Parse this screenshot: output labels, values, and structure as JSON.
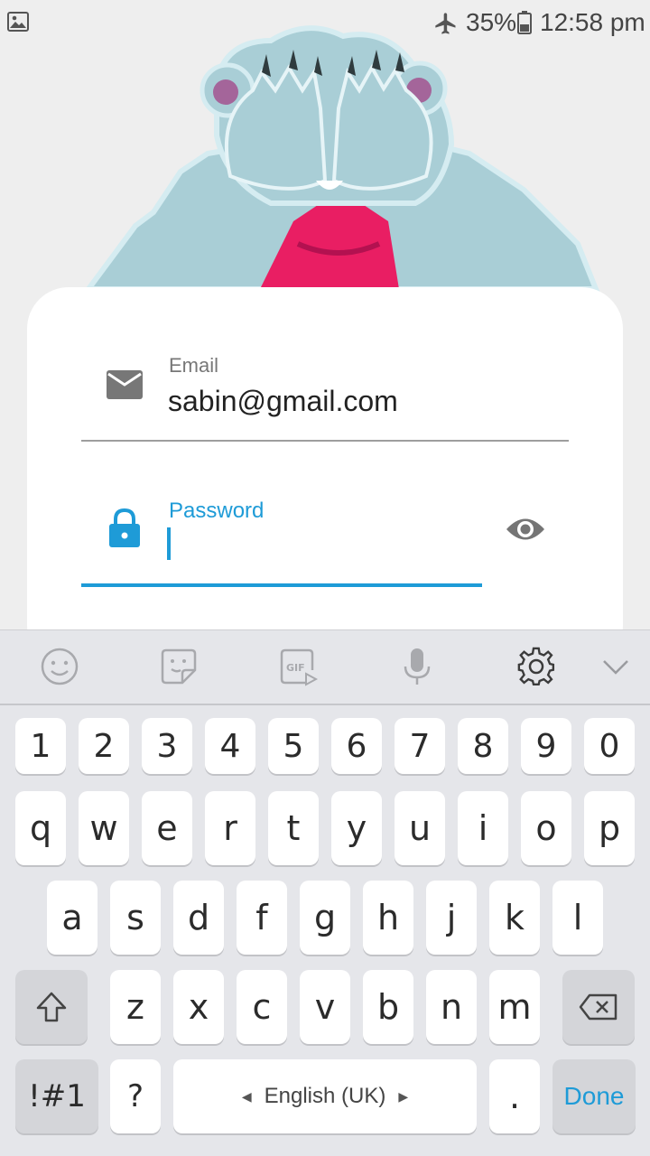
{
  "status_bar": {
    "battery_percent": "35%",
    "time": "12:58 pm"
  },
  "form": {
    "email_label": "Email",
    "email_value": "sabin@gmail.com",
    "password_label": "Password",
    "password_value": ""
  },
  "keyboard": {
    "toolbar_icons": [
      "emoji-icon",
      "sticker-icon",
      "gif-icon",
      "microphone-icon",
      "settings-icon",
      "collapse-icon"
    ],
    "gif_label": "GIF",
    "number_row": [
      "1",
      "2",
      "3",
      "4",
      "5",
      "6",
      "7",
      "8",
      "9",
      "0"
    ],
    "row1": [
      "q",
      "w",
      "e",
      "r",
      "t",
      "y",
      "u",
      "i",
      "o",
      "p"
    ],
    "row2": [
      "a",
      "s",
      "d",
      "f",
      "g",
      "h",
      "j",
      "k",
      "l"
    ],
    "row3": [
      "z",
      "x",
      "c",
      "v",
      "b",
      "n",
      "m"
    ],
    "symbols_label": "!#1",
    "question_label": "?",
    "space_label": "English (UK)",
    "period_label": ".",
    "done_label": "Done"
  },
  "colors": {
    "accent": "#1e9bd7",
    "mascot_fur": "#a9ced6",
    "mascot_shirt": "#e91e63"
  }
}
